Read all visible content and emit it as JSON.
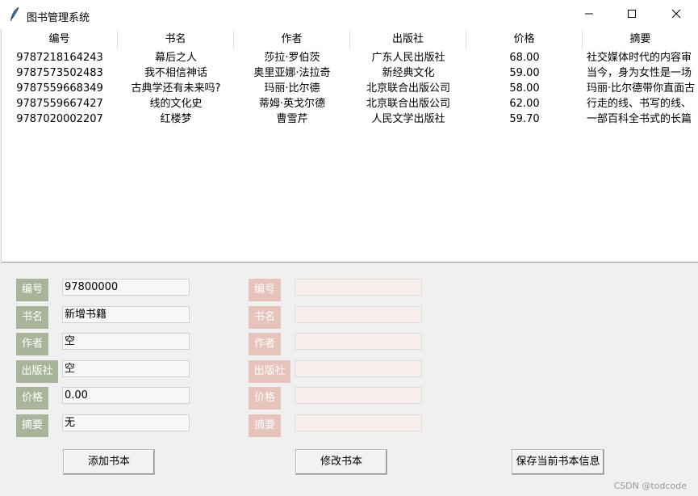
{
  "window": {
    "title": "图书管理系统",
    "icon": "feather-icon",
    "controls": [
      "minimize-icon",
      "maximize-icon",
      "close-icon"
    ]
  },
  "table": {
    "columns": [
      "编号",
      "书名",
      "作者",
      "出版社",
      "价格",
      "摘要"
    ],
    "rows": [
      [
        "9787218164243",
        "幕后之人",
        "莎拉·罗伯茨",
        "广东人民出版社",
        "68.00",
        "社交媒体时代的内容审"
      ],
      [
        "9787573502483",
        "我不相信神话",
        "奥里亚娜·法拉奇",
        "新经典文化",
        "59.00",
        "当今，身为女性是一场"
      ],
      [
        "9787559668349",
        "古典学还有未来吗?",
        "玛丽·比尔德",
        "北京联合出版公司",
        "58.00",
        "玛丽·比尔德带你直面古"
      ],
      [
        "9787559667427",
        "线的文化史",
        "蒂姆·英戈尔德",
        "北京联合出版公司",
        "62.00",
        "行走的线、书写的线、"
      ],
      [
        "9787020002207",
        "红楼梦",
        "曹雪芹",
        "人民文学出版社",
        "59.70",
        "一部百科全书式的长篇"
      ]
    ]
  },
  "form_left": {
    "fields": [
      {
        "label": "编号",
        "value": "97800000"
      },
      {
        "label": "书名",
        "value": "新增书籍"
      },
      {
        "label": "作者",
        "value": "空"
      },
      {
        "label": "出版社",
        "value": "空"
      },
      {
        "label": "价格",
        "value": "0.00"
      },
      {
        "label": "摘要",
        "value": "无"
      }
    ]
  },
  "form_right": {
    "fields": [
      {
        "label": "编号",
        "value": ""
      },
      {
        "label": "书名",
        "value": ""
      },
      {
        "label": "作者",
        "value": ""
      },
      {
        "label": "出版社",
        "value": ""
      },
      {
        "label": "价格",
        "value": ""
      },
      {
        "label": "摘要",
        "value": ""
      }
    ]
  },
  "buttons": {
    "add": "添加书本",
    "edit": "修改书本",
    "save": "保存当前书本信息"
  },
  "watermark": "CSDN @todcode",
  "colors": {
    "label_left": "#a9b59a",
    "label_right": "#e6c3bb",
    "entry_right_bg": "#f8eeec"
  }
}
